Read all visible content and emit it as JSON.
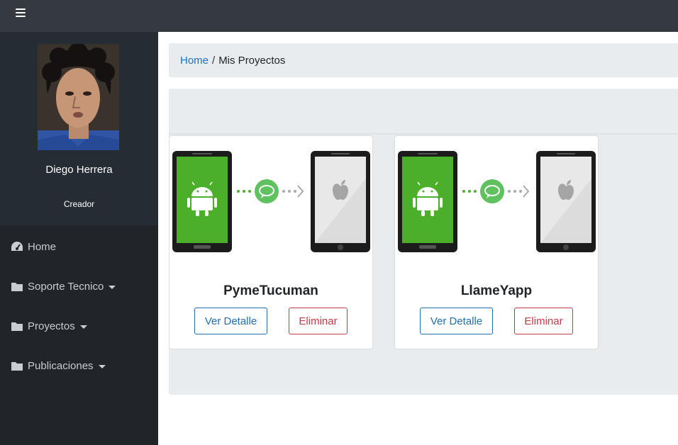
{
  "topbar": {
    "menu_icon": "hamburger-menu-icon"
  },
  "sidebar": {
    "user": {
      "name": "Diego Herrera",
      "role": "Creador"
    },
    "items": [
      {
        "label": "Home",
        "icon": "dashboard-icon",
        "has_caret": false
      },
      {
        "label": "Soporte Tecnico",
        "icon": "folder-icon",
        "has_caret": true
      },
      {
        "label": "Proyectos",
        "icon": "folder-icon",
        "has_caret": true
      },
      {
        "label": "Publicaciones",
        "icon": "folder-icon",
        "has_caret": true
      }
    ]
  },
  "breadcrumb": {
    "home": "Home",
    "separator": "/",
    "current": "Mis Proyectos"
  },
  "projects": [
    {
      "title": "PymeTucuman",
      "detail_label": "Ver Detalle",
      "delete_label": "Eliminar"
    },
    {
      "title": "LlameYapp",
      "detail_label": "Ver Detalle",
      "delete_label": "Eliminar"
    }
  ],
  "colors": {
    "topbar": "#343a40",
    "sidebar": "#212529",
    "link": "#1a73c8",
    "primary_outline": "#1f6fb2",
    "danger_outline": "#c23b47",
    "android_green": "#4caf2a",
    "chat_green": "#5fc25f"
  }
}
